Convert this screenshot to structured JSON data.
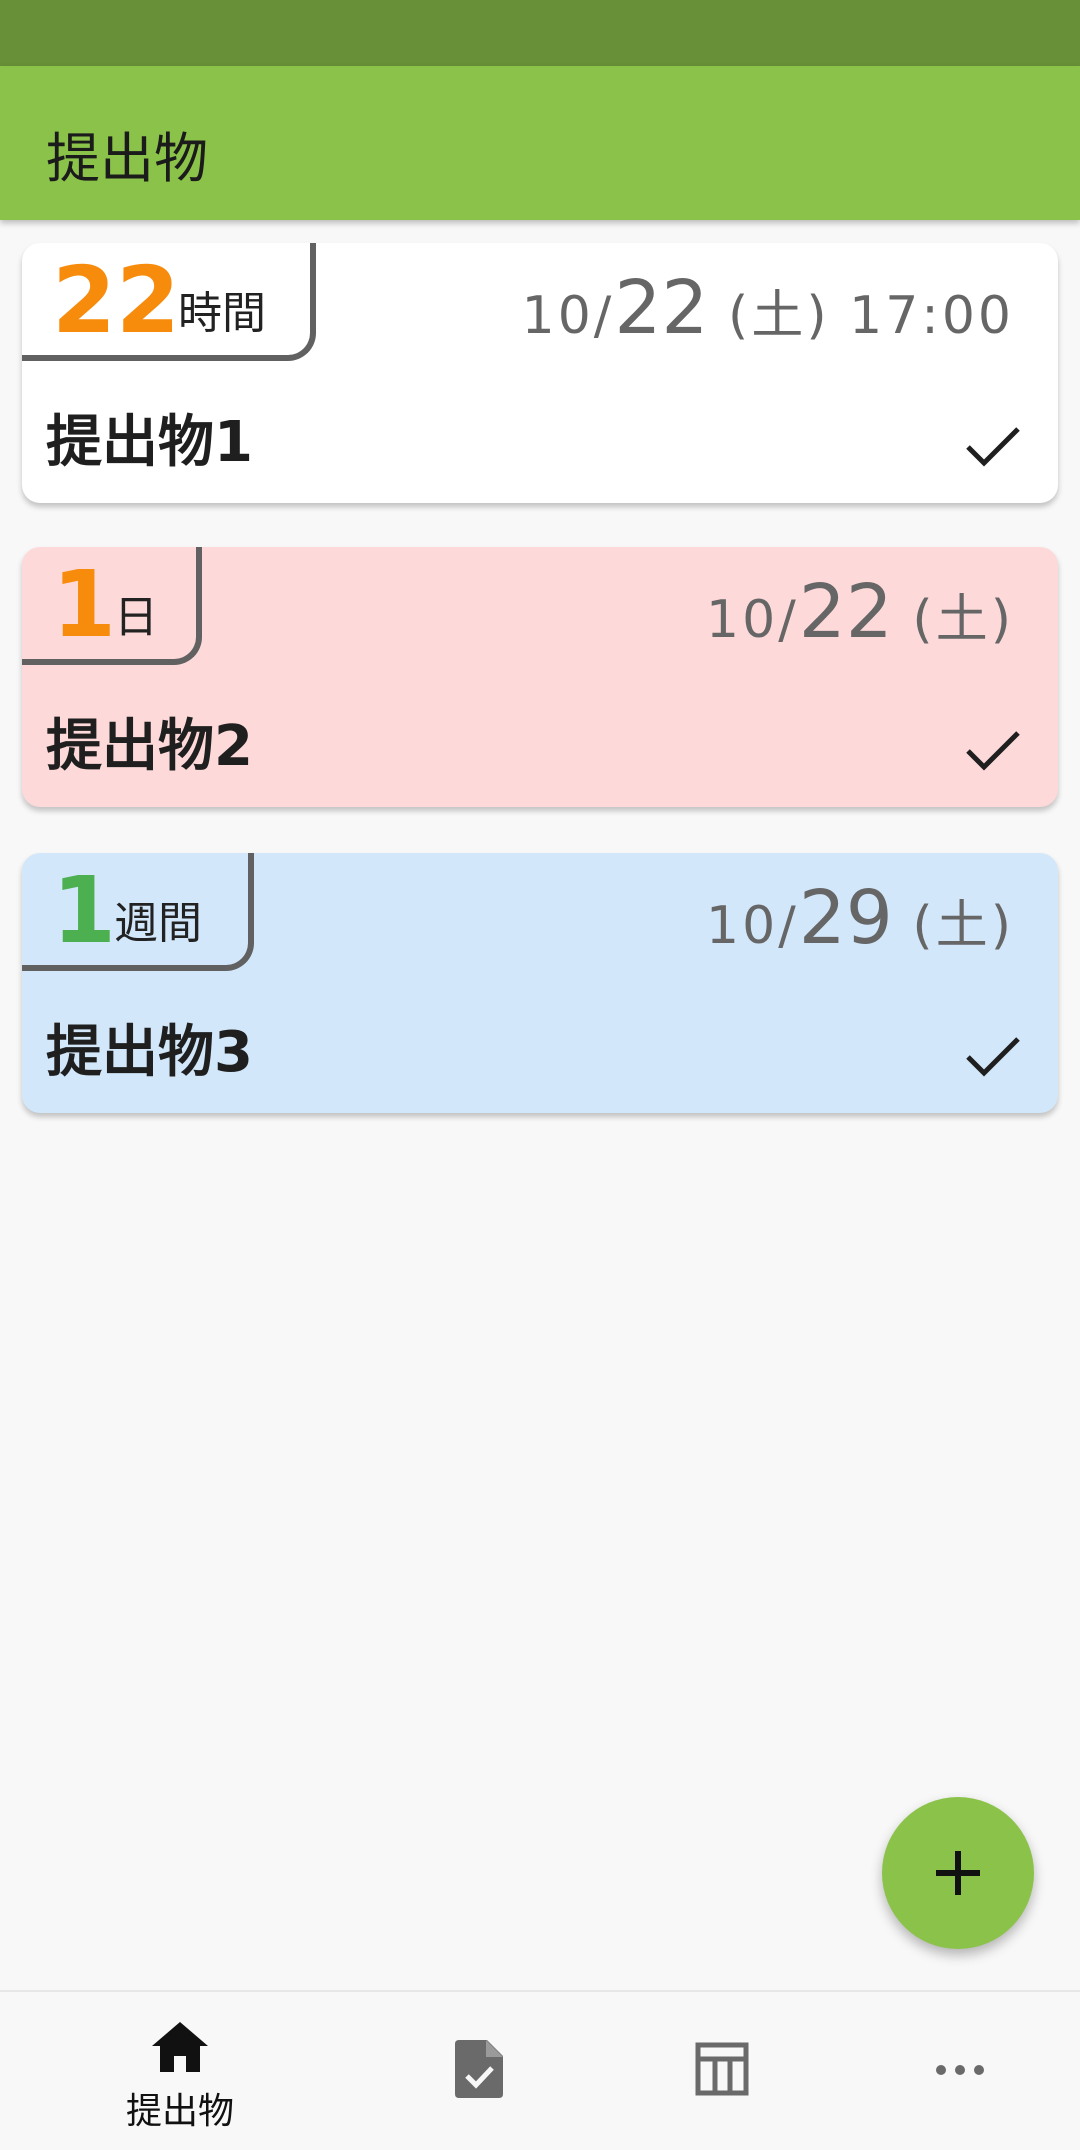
{
  "app_bar": {
    "title": "提出物"
  },
  "assignments": [
    {
      "remaining_value": "22",
      "remaining_unit": "時間",
      "month": "10/",
      "day": "22",
      "weekday": " (土) ",
      "time": "17:00",
      "name": "提出物1",
      "bg": "#ffffff",
      "accent": "#f68b0c"
    },
    {
      "remaining_value": "1",
      "remaining_unit": "日",
      "month": "10/",
      "day": "22",
      "weekday": " (土)",
      "time": "",
      "name": "提出物2",
      "bg": "#fdd9d9",
      "accent": "#f68b0c"
    },
    {
      "remaining_value": "1",
      "remaining_unit": "週間",
      "month": "10/",
      "day": "29",
      "weekday": " (土)",
      "time": "",
      "name": "提出物3",
      "bg": "#d2e7fa",
      "accent": "#4caf50"
    }
  ],
  "fab": {
    "icon": "plus-icon"
  },
  "bottom_nav": {
    "items": [
      {
        "icon": "home-icon",
        "label": "提出物"
      },
      {
        "icon": "task-file-icon",
        "label": ""
      },
      {
        "icon": "timetable-icon",
        "label": ""
      },
      {
        "icon": "more-icon",
        "label": ""
      }
    ]
  }
}
